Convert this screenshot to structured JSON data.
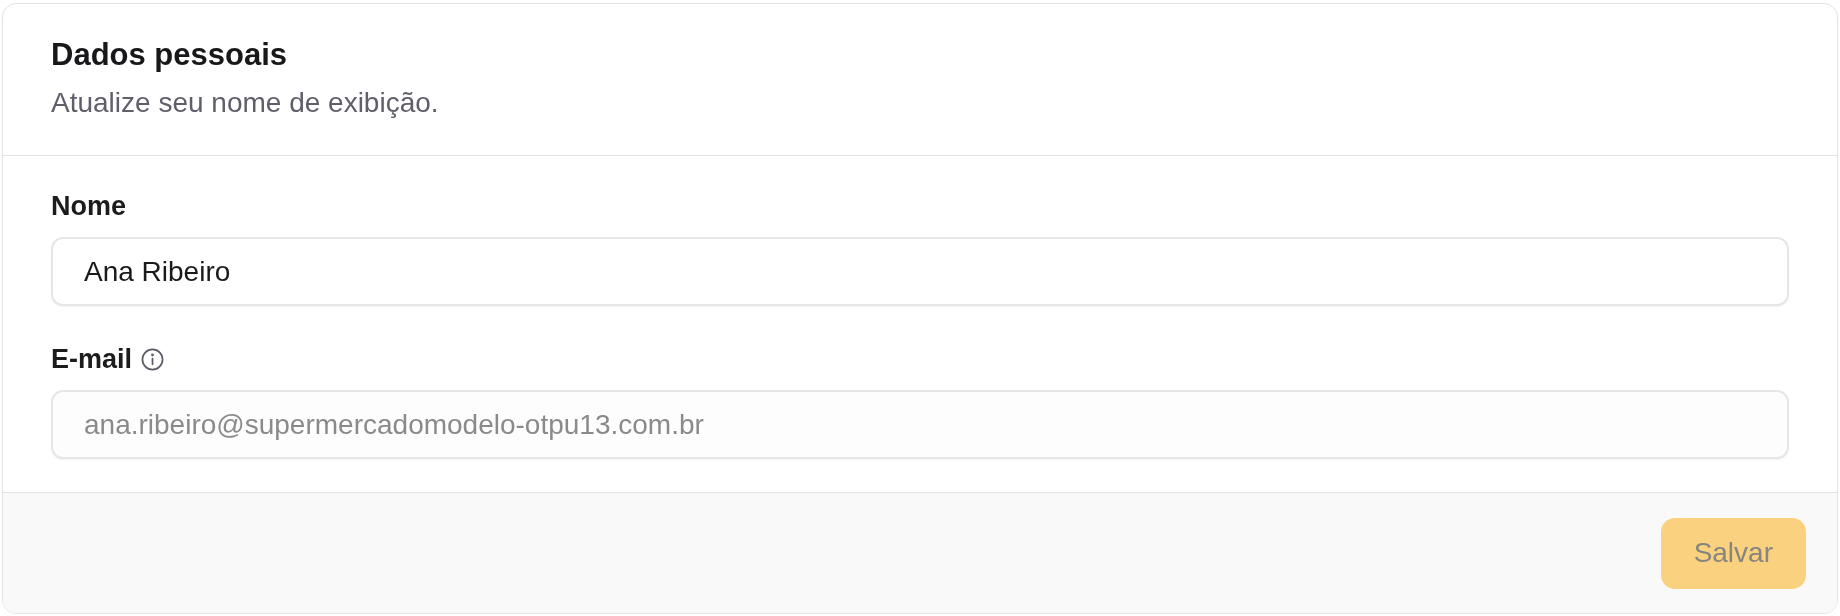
{
  "card": {
    "title": "Dados pessoais",
    "description": "Atualize seu nome de exibição."
  },
  "fields": [
    {
      "label": "Nome",
      "value": "Ana Ribeiro",
      "disabled": false,
      "info": false
    },
    {
      "label": "E-mail",
      "value": "ana.ribeiro@supermercadomodelo-otpu13.com.br",
      "disabled": true,
      "info": true
    }
  ],
  "footer": {
    "button": {
      "label": "Salvar",
      "disabled": true
    }
  }
}
